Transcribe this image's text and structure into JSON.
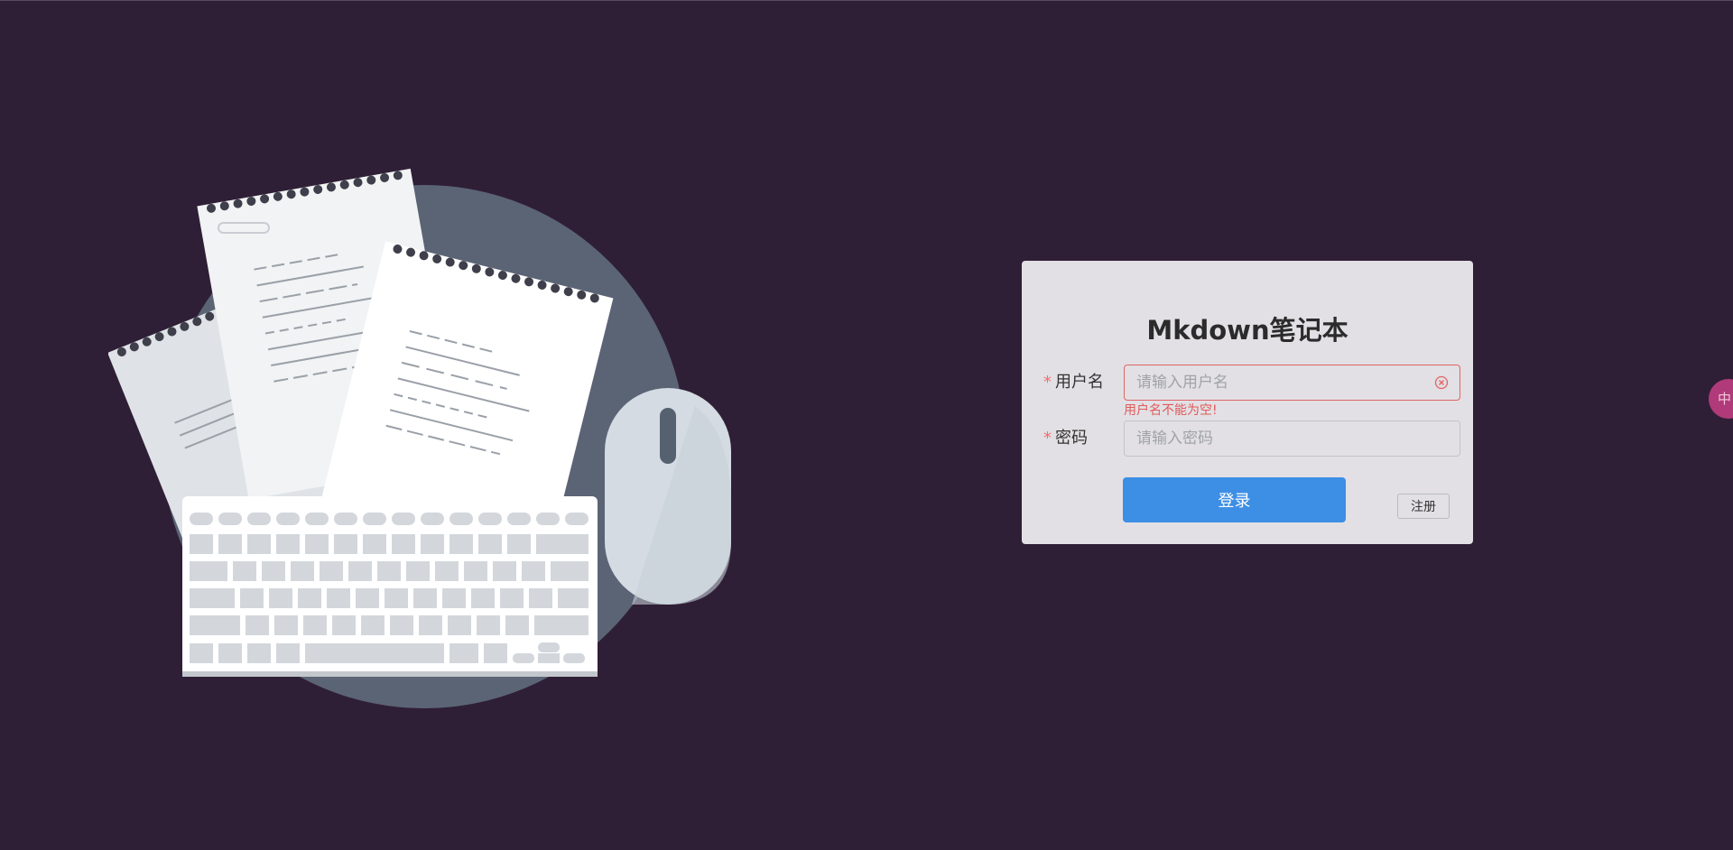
{
  "login": {
    "title": "Mkdown笔记本",
    "username": {
      "required_mark": "*",
      "label": "用户名",
      "placeholder": "请输入用户名",
      "value": "",
      "error": "用户名不能为空!"
    },
    "password": {
      "required_mark": "*",
      "label": "密码",
      "placeholder": "请输入密码",
      "value": ""
    },
    "submit_label": "登录",
    "register_label": "注册"
  },
  "ime": {
    "label": "中"
  },
  "colors": {
    "background": "#2f1f36",
    "card": "#e2e0e4",
    "primary": "#3d8ee5",
    "error": "#e05a5a"
  }
}
